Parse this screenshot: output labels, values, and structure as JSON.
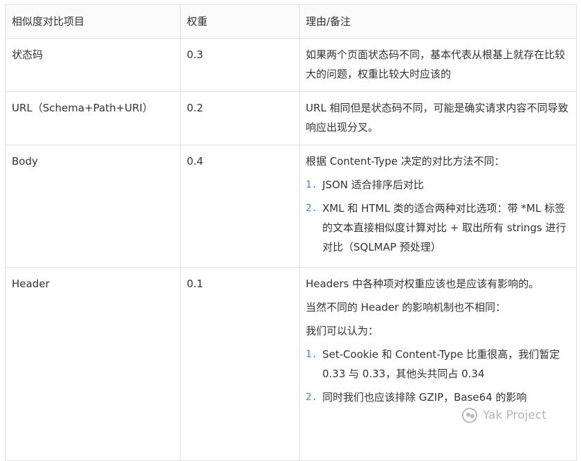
{
  "table": {
    "headers": [
      "相似度对比项目",
      "权重",
      "理由/备注"
    ],
    "rows": {
      "status": {
        "item": "状态码",
        "weight": "0.3",
        "note": "如果两个页面状态码不同，基本代表从根基上就存在比较大的问题，权重比较大时应该的"
      },
      "url": {
        "item": "URL（Schema+Path+URI）",
        "weight": "0.2",
        "note": "URL 相同但是状态码不同，可能是确实请求内容不同导致响应出现分叉。"
      },
      "body": {
        "item": "Body",
        "weight": "0.4",
        "intro": "根据 Content-Type 决定的对比方法不同：",
        "list": [
          {
            "num": "1.",
            "text": "JSON 适合排序后对比"
          },
          {
            "num": "2.",
            "text": "XML 和 HTML 类的适合两种对比选项：带 *ML 标签的文本直接相似度计算对比 + 取出所有 strings 进行对比（SQLMAP 预处理）"
          }
        ]
      },
      "header": {
        "item": "Header",
        "weight": "0.1",
        "p1": "Headers 中各种项对权重应该也是应该有影响的。",
        "p2": "当然不同的 Header 的影响机制也不相同：",
        "p3": "我们可以认为：",
        "list": [
          {
            "num": "1.",
            "text": "Set-Cookie 和 Content-Type 比重很高，我们暂定 0.33 与 0.33，其他头共同占 0.34"
          },
          {
            "num": "2.",
            "text": "同时我们也应该排除 GZIP，Base64 的影响"
          }
        ]
      }
    }
  },
  "watermark": {
    "icon": "wechat-icon",
    "text": "Yak Project"
  }
}
